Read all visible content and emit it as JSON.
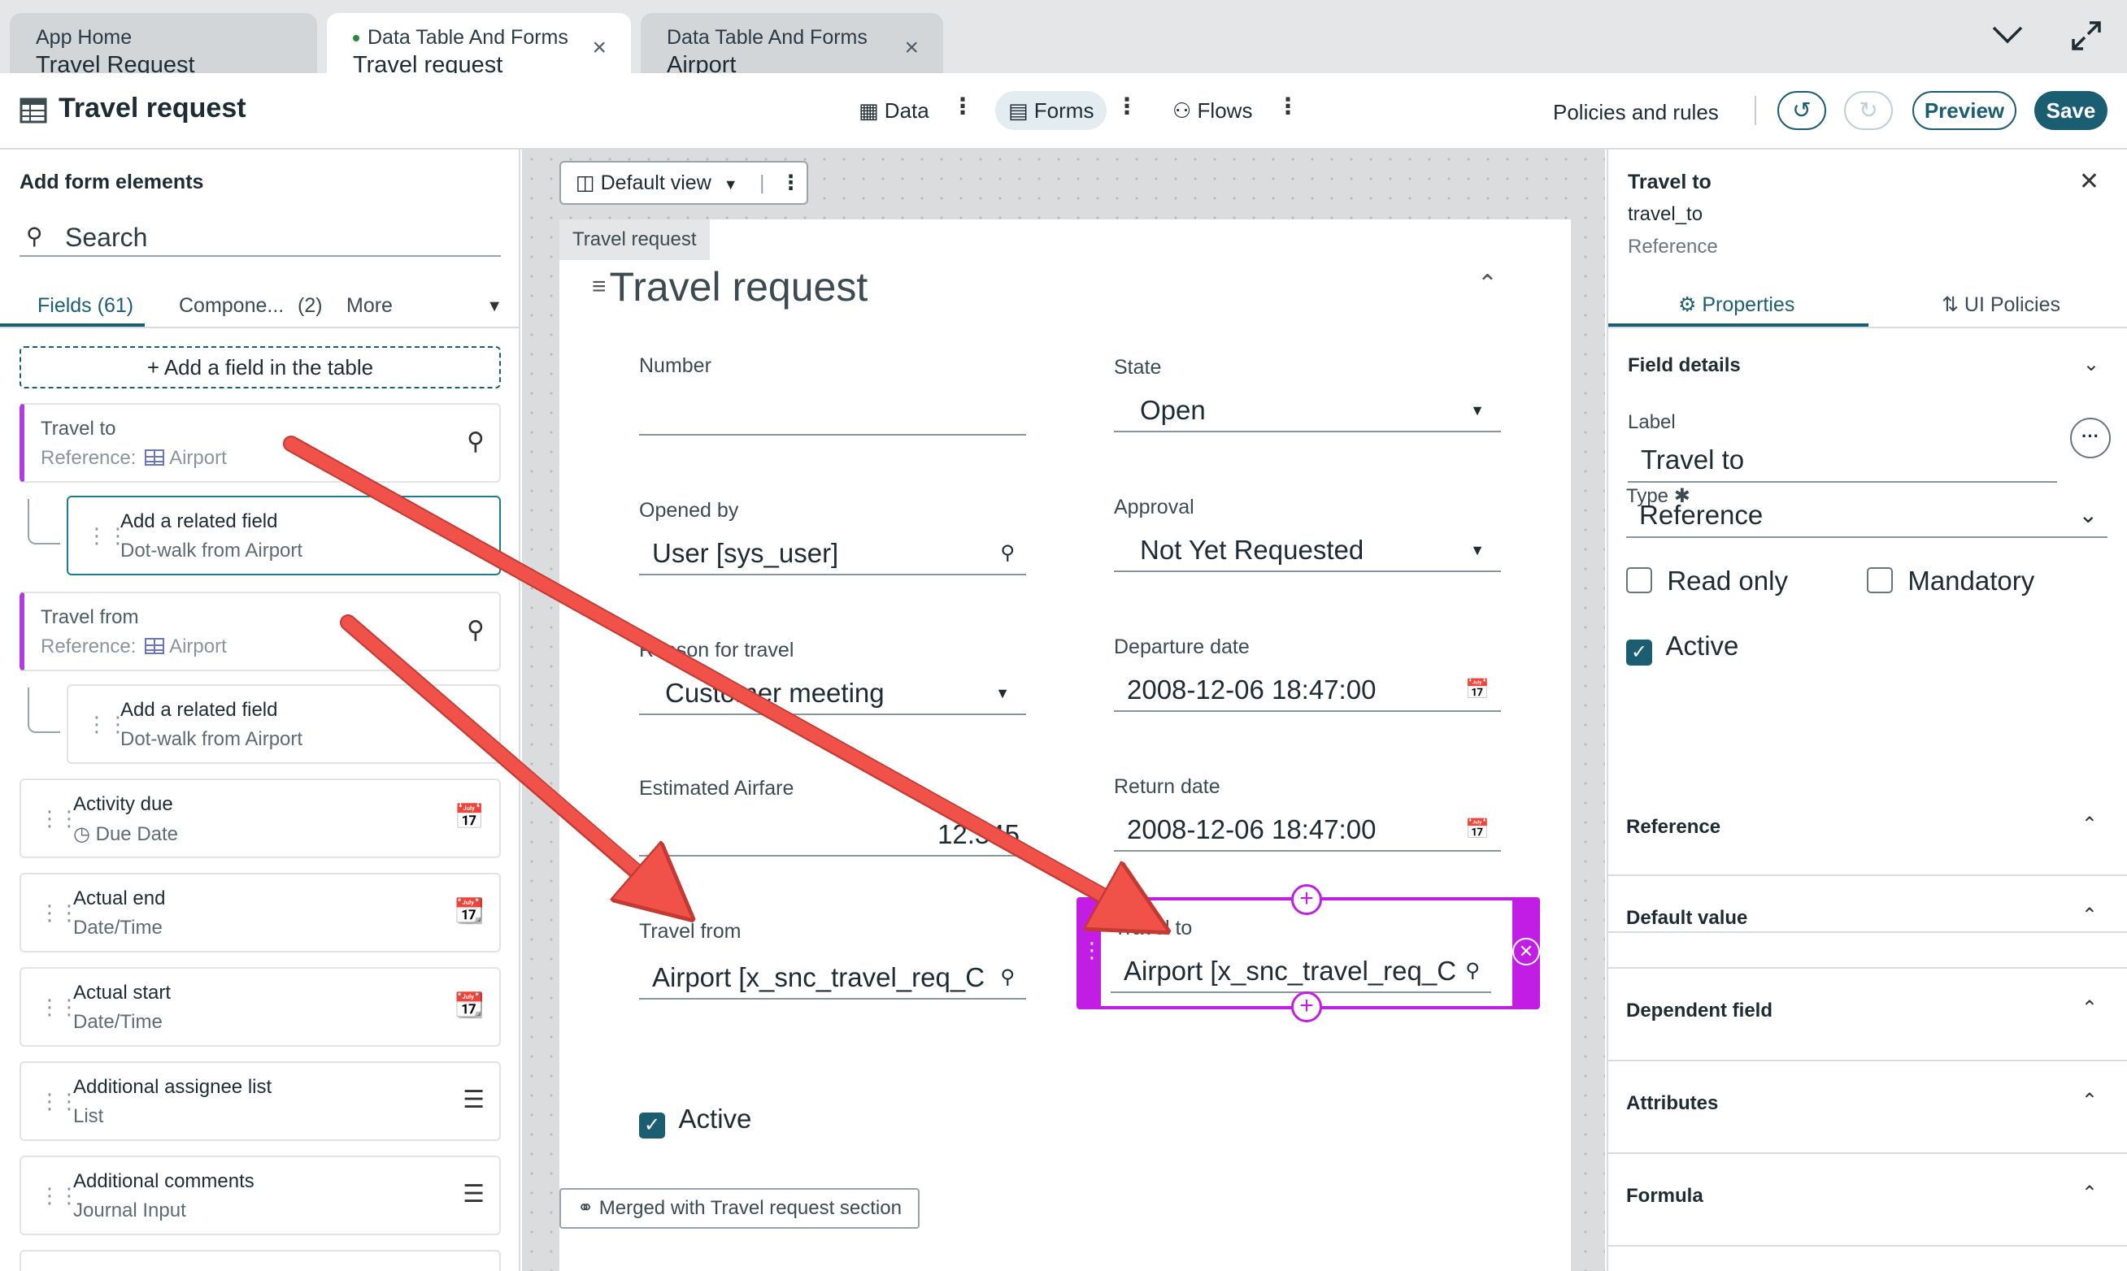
{
  "tabs": [
    {
      "line1": "App Home",
      "line2": "Travel Request"
    },
    {
      "line1": "Data Table And Forms",
      "line2": "Travel request",
      "close": "×"
    },
    {
      "line1": "Data Table And Forms",
      "line2": "Airport",
      "close": "×"
    }
  ],
  "window_icons": {
    "chevron": "chevron-down-icon",
    "expand": "expand-icon"
  },
  "header": {
    "title": "Travel request",
    "nav": {
      "data": "Data",
      "forms": "Forms",
      "flows": "Flows"
    },
    "policies": "Policies and rules",
    "preview": "Preview",
    "save": "Save"
  },
  "left": {
    "title": "Add form elements",
    "search_placeholder": "Search",
    "tabs": {
      "fields": "Fields (61)",
      "components": "Compone...",
      "components_count": "(2)",
      "more": "More"
    },
    "add_field": "+ Add a field in the table",
    "travel_to": {
      "name": "Travel to",
      "type": "Reference:",
      "table": "Airport"
    },
    "travel_from": {
      "name": "Travel from",
      "type": "Reference:",
      "table": "Airport"
    },
    "related": {
      "title": "Add a related field",
      "sub": "Dot-walk from Airport"
    },
    "fields": [
      {
        "name": "Activity due",
        "type": "Due Date"
      },
      {
        "name": "Actual end",
        "type": "Date/Time"
      },
      {
        "name": "Actual start",
        "type": "Date/Time"
      },
      {
        "name": "Additional assignee list",
        "type": "List"
      },
      {
        "name": "Additional comments",
        "type": "Journal Input"
      }
    ]
  },
  "canvas": {
    "view": "Default view",
    "section_tag": "Travel request",
    "form_title": "Travel request",
    "fields": {
      "number": {
        "label": "Number",
        "value": ""
      },
      "state": {
        "label": "State",
        "value": "Open"
      },
      "opened_by": {
        "label": "Opened by",
        "value": "User [sys_user]"
      },
      "approval": {
        "label": "Approval",
        "value": "Not Yet Requested"
      },
      "reason": {
        "label": "Reason for travel",
        "value": "Customer meeting"
      },
      "departure": {
        "label": "Departure date",
        "value": "2008-12-06 18:47:00"
      },
      "airfare": {
        "label": "Estimated Airfare",
        "value": "12.345"
      },
      "return": {
        "label": "Return date",
        "value": "2008-12-06 18:47:00"
      },
      "travel_from": {
        "label": "Travel from",
        "value": "Airport [x_snc_travel_req_C"
      },
      "travel_to": {
        "label": "Travel to",
        "value": "Airport [x_snc_travel_req_C"
      },
      "active": {
        "label": "Active"
      }
    },
    "merged": "Merged with Travel request section"
  },
  "right": {
    "field_title": "Travel to",
    "field_name": "travel_to",
    "field_type": "Reference",
    "tabs": {
      "properties": "Properties",
      "ui_policies": "UI Policies"
    },
    "sections": {
      "details": "Field details",
      "reference": "Reference",
      "default_value": "Default value",
      "dependent": "Dependent field",
      "attributes": "Attributes",
      "formula": "Formula"
    },
    "label_label": "Label",
    "label_value": "Travel to",
    "type_label": "Type",
    "type_value": "Reference",
    "read_only": "Read only",
    "mandatory": "Mandatory",
    "active": "Active"
  },
  "colors": {
    "accent": "#1b5e72",
    "selection": "#c21de5",
    "arrow": "#f0524a",
    "reference_bar": "#b13de1"
  }
}
